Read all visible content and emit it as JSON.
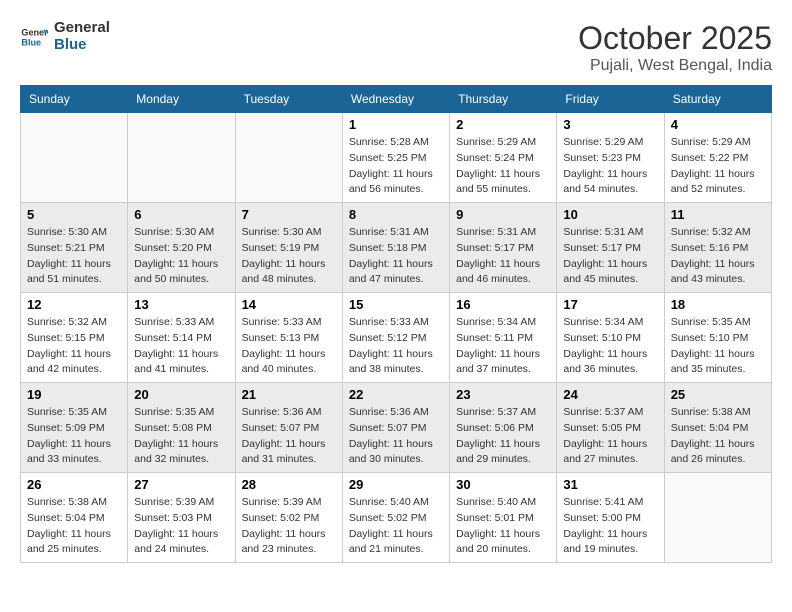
{
  "header": {
    "logo_line1": "General",
    "logo_line2": "Blue",
    "month": "October 2025",
    "location": "Pujali, West Bengal, India"
  },
  "weekdays": [
    "Sunday",
    "Monday",
    "Tuesday",
    "Wednesday",
    "Thursday",
    "Friday",
    "Saturday"
  ],
  "weeks": [
    [
      {
        "day": "",
        "sunrise": "",
        "sunset": "",
        "daylight": ""
      },
      {
        "day": "",
        "sunrise": "",
        "sunset": "",
        "daylight": ""
      },
      {
        "day": "",
        "sunrise": "",
        "sunset": "",
        "daylight": ""
      },
      {
        "day": "1",
        "sunrise": "Sunrise: 5:28 AM",
        "sunset": "Sunset: 5:25 PM",
        "daylight": "Daylight: 11 hours and 56 minutes."
      },
      {
        "day": "2",
        "sunrise": "Sunrise: 5:29 AM",
        "sunset": "Sunset: 5:24 PM",
        "daylight": "Daylight: 11 hours and 55 minutes."
      },
      {
        "day": "3",
        "sunrise": "Sunrise: 5:29 AM",
        "sunset": "Sunset: 5:23 PM",
        "daylight": "Daylight: 11 hours and 54 minutes."
      },
      {
        "day": "4",
        "sunrise": "Sunrise: 5:29 AM",
        "sunset": "Sunset: 5:22 PM",
        "daylight": "Daylight: 11 hours and 52 minutes."
      }
    ],
    [
      {
        "day": "5",
        "sunrise": "Sunrise: 5:30 AM",
        "sunset": "Sunset: 5:21 PM",
        "daylight": "Daylight: 11 hours and 51 minutes."
      },
      {
        "day": "6",
        "sunrise": "Sunrise: 5:30 AM",
        "sunset": "Sunset: 5:20 PM",
        "daylight": "Daylight: 11 hours and 50 minutes."
      },
      {
        "day": "7",
        "sunrise": "Sunrise: 5:30 AM",
        "sunset": "Sunset: 5:19 PM",
        "daylight": "Daylight: 11 hours and 48 minutes."
      },
      {
        "day": "8",
        "sunrise": "Sunrise: 5:31 AM",
        "sunset": "Sunset: 5:18 PM",
        "daylight": "Daylight: 11 hours and 47 minutes."
      },
      {
        "day": "9",
        "sunrise": "Sunrise: 5:31 AM",
        "sunset": "Sunset: 5:17 PM",
        "daylight": "Daylight: 11 hours and 46 minutes."
      },
      {
        "day": "10",
        "sunrise": "Sunrise: 5:31 AM",
        "sunset": "Sunset: 5:17 PM",
        "daylight": "Daylight: 11 hours and 45 minutes."
      },
      {
        "day": "11",
        "sunrise": "Sunrise: 5:32 AM",
        "sunset": "Sunset: 5:16 PM",
        "daylight": "Daylight: 11 hours and 43 minutes."
      }
    ],
    [
      {
        "day": "12",
        "sunrise": "Sunrise: 5:32 AM",
        "sunset": "Sunset: 5:15 PM",
        "daylight": "Daylight: 11 hours and 42 minutes."
      },
      {
        "day": "13",
        "sunrise": "Sunrise: 5:33 AM",
        "sunset": "Sunset: 5:14 PM",
        "daylight": "Daylight: 11 hours and 41 minutes."
      },
      {
        "day": "14",
        "sunrise": "Sunrise: 5:33 AM",
        "sunset": "Sunset: 5:13 PM",
        "daylight": "Daylight: 11 hours and 40 minutes."
      },
      {
        "day": "15",
        "sunrise": "Sunrise: 5:33 AM",
        "sunset": "Sunset: 5:12 PM",
        "daylight": "Daylight: 11 hours and 38 minutes."
      },
      {
        "day": "16",
        "sunrise": "Sunrise: 5:34 AM",
        "sunset": "Sunset: 5:11 PM",
        "daylight": "Daylight: 11 hours and 37 minutes."
      },
      {
        "day": "17",
        "sunrise": "Sunrise: 5:34 AM",
        "sunset": "Sunset: 5:10 PM",
        "daylight": "Daylight: 11 hours and 36 minutes."
      },
      {
        "day": "18",
        "sunrise": "Sunrise: 5:35 AM",
        "sunset": "Sunset: 5:10 PM",
        "daylight": "Daylight: 11 hours and 35 minutes."
      }
    ],
    [
      {
        "day": "19",
        "sunrise": "Sunrise: 5:35 AM",
        "sunset": "Sunset: 5:09 PM",
        "daylight": "Daylight: 11 hours and 33 minutes."
      },
      {
        "day": "20",
        "sunrise": "Sunrise: 5:35 AM",
        "sunset": "Sunset: 5:08 PM",
        "daylight": "Daylight: 11 hours and 32 minutes."
      },
      {
        "day": "21",
        "sunrise": "Sunrise: 5:36 AM",
        "sunset": "Sunset: 5:07 PM",
        "daylight": "Daylight: 11 hours and 31 minutes."
      },
      {
        "day": "22",
        "sunrise": "Sunrise: 5:36 AM",
        "sunset": "Sunset: 5:07 PM",
        "daylight": "Daylight: 11 hours and 30 minutes."
      },
      {
        "day": "23",
        "sunrise": "Sunrise: 5:37 AM",
        "sunset": "Sunset: 5:06 PM",
        "daylight": "Daylight: 11 hours and 29 minutes."
      },
      {
        "day": "24",
        "sunrise": "Sunrise: 5:37 AM",
        "sunset": "Sunset: 5:05 PM",
        "daylight": "Daylight: 11 hours and 27 minutes."
      },
      {
        "day": "25",
        "sunrise": "Sunrise: 5:38 AM",
        "sunset": "Sunset: 5:04 PM",
        "daylight": "Daylight: 11 hours and 26 minutes."
      }
    ],
    [
      {
        "day": "26",
        "sunrise": "Sunrise: 5:38 AM",
        "sunset": "Sunset: 5:04 PM",
        "daylight": "Daylight: 11 hours and 25 minutes."
      },
      {
        "day": "27",
        "sunrise": "Sunrise: 5:39 AM",
        "sunset": "Sunset: 5:03 PM",
        "daylight": "Daylight: 11 hours and 24 minutes."
      },
      {
        "day": "28",
        "sunrise": "Sunrise: 5:39 AM",
        "sunset": "Sunset: 5:02 PM",
        "daylight": "Daylight: 11 hours and 23 minutes."
      },
      {
        "day": "29",
        "sunrise": "Sunrise: 5:40 AM",
        "sunset": "Sunset: 5:02 PM",
        "daylight": "Daylight: 11 hours and 21 minutes."
      },
      {
        "day": "30",
        "sunrise": "Sunrise: 5:40 AM",
        "sunset": "Sunset: 5:01 PM",
        "daylight": "Daylight: 11 hours and 20 minutes."
      },
      {
        "day": "31",
        "sunrise": "Sunrise: 5:41 AM",
        "sunset": "Sunset: 5:00 PM",
        "daylight": "Daylight: 11 hours and 19 minutes."
      },
      {
        "day": "",
        "sunrise": "",
        "sunset": "",
        "daylight": ""
      }
    ]
  ]
}
